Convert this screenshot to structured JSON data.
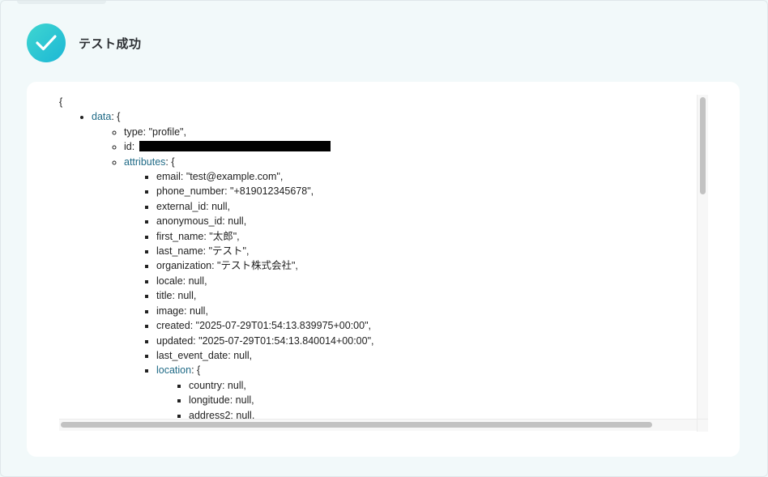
{
  "header": {
    "title": "テスト成功",
    "icon": "check-icon",
    "accent_color": "#22c1d3"
  },
  "json_view": {
    "open_brace": "{",
    "data_key": "data",
    "data_suffix": ": {",
    "type_line": "type: \"profile\",",
    "id_label": "id:",
    "attributes_key": "attributes",
    "attributes_suffix": ": {",
    "attributes": [
      "email: \"test@example.com\",",
      "phone_number: \"+819012345678\",",
      "external_id: null,",
      "anonymous_id: null,",
      "first_name: \"太郎\",",
      "last_name: \"テスト\",",
      "organization: \"テスト株式会社\",",
      "locale: null,",
      "title: null,",
      "image: null,",
      "created: \"2025-07-29T01:54:13.839975+00:00\",",
      "updated: \"2025-07-29T01:54:13.840014+00:00\",",
      "last_event_date: null,"
    ],
    "location_key": "location",
    "location_suffix": ": {",
    "location": [
      "country: null,",
      "longitude: null,",
      "address2: null,"
    ]
  },
  "colors": {
    "key_link": "#1f6a86",
    "background": "#f2f9fa",
    "card": "#ffffff"
  }
}
